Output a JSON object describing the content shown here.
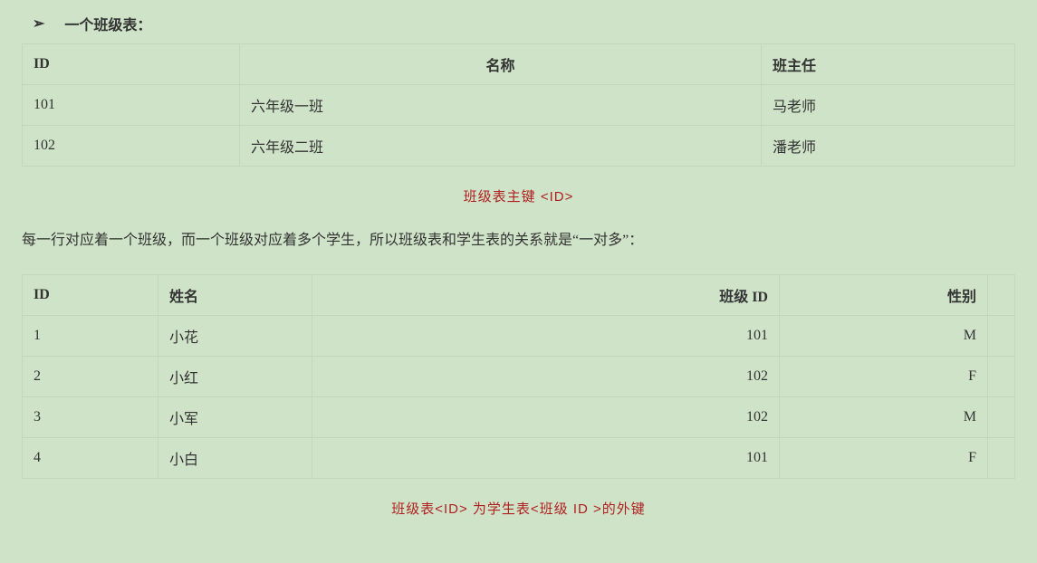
{
  "bullet": {
    "arrow": "➢",
    "title": "一个班级表："
  },
  "class_table": {
    "headers": {
      "id": "ID",
      "name": "名称",
      "teacher": "班主任"
    },
    "rows": [
      {
        "id": "101",
        "name": "六年级一班",
        "teacher": "马老师"
      },
      {
        "id": "102",
        "name": "六年级二班",
        "teacher": "潘老师"
      }
    ]
  },
  "caption1": {
    "prefix": "班级表主键",
    "tag": "  <ID>"
  },
  "paragraph": "每一行对应着一个班级，而一个班级对应着多个学生，所以班级表和学生表的关系就是“一对多”：",
  "student_table": {
    "headers": {
      "id": "ID",
      "name": "姓名",
      "class_id": "班级 ID",
      "gender": "性别"
    },
    "rows": [
      {
        "id": "1",
        "name": "小花",
        "class_id": "101",
        "gender": "M"
      },
      {
        "id": "2",
        "name": "小红",
        "class_id": "102",
        "gender": "F"
      },
      {
        "id": "3",
        "name": "小军",
        "class_id": "102",
        "gender": "M"
      },
      {
        "id": "4",
        "name": "小白",
        "class_id": "101",
        "gender": "F"
      }
    ]
  },
  "caption2": {
    "p1": "班级表",
    "t1": "<ID>",
    "p2": "  为学生表",
    "t2": "<班级 ID >",
    "p3": "的外键"
  }
}
